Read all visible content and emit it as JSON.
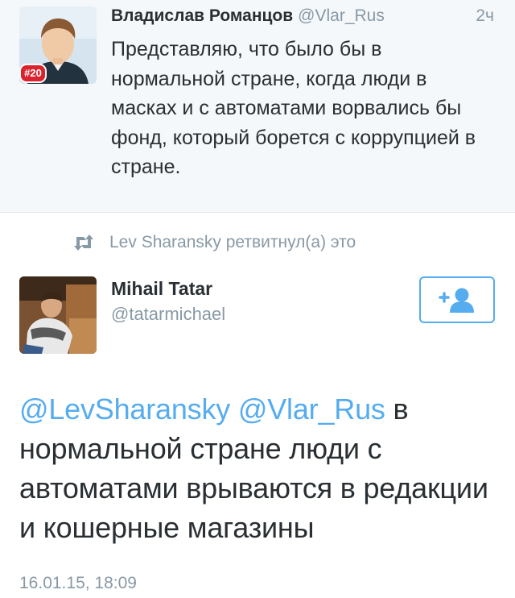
{
  "quoted_tweet": {
    "author_name": "Владислав Романцов",
    "author_handle": "@Vlar_Rus",
    "time_ago": "2ч",
    "avatar_badge": "#20",
    "text": "Представляю, что было бы в нормальной стране, когда люди в масках и с автоматами ворвались бы фонд, который борется с коррупцией в стране."
  },
  "retweet_notice": {
    "icon": "retweet-icon",
    "text": "Lev Sharansky ретвитнул(а) это"
  },
  "tweet": {
    "author_name": "Mihail Tatar",
    "author_handle": "@tatarmichael",
    "follow_button_icon": "add-user-icon",
    "mention_1": "@LevSharansky",
    "mention_2": "@Vlar_Rus",
    "text": " в нормальной стране люди с автоматами врываются в редакции и кошерные магазины",
    "date": "16.01.15, 18:09"
  },
  "colors": {
    "accent": "#55acee",
    "muted": "#8899a6",
    "text": "#292f33",
    "badge": "#d9232e",
    "quoted_bg": "#f5f8fa"
  }
}
